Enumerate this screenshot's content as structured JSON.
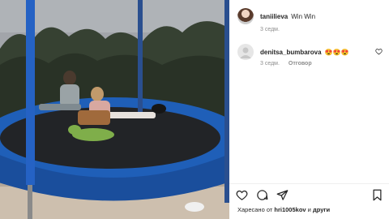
{
  "post": {
    "author": "taniilieva",
    "caption": "Win Win",
    "caption_time": "3 седм."
  },
  "comments": [
    {
      "author": "denitsa_bumbarova",
      "text": "😍😍😍",
      "time": "3 седм.",
      "reply_label": "Отговор"
    }
  ],
  "actions": {
    "like_icon": "heart-icon",
    "comment_icon": "comment-icon",
    "share_icon": "share-icon",
    "save_icon": "bookmark-icon"
  },
  "likes": {
    "prefix": "Харесано от",
    "user": "hri1005kov",
    "conjunction": "и",
    "others": "други"
  },
  "colors": {
    "trampoline_pad": "#1f5fb8",
    "text_primary": "#262626",
    "text_secondary": "#8e8e8e"
  }
}
